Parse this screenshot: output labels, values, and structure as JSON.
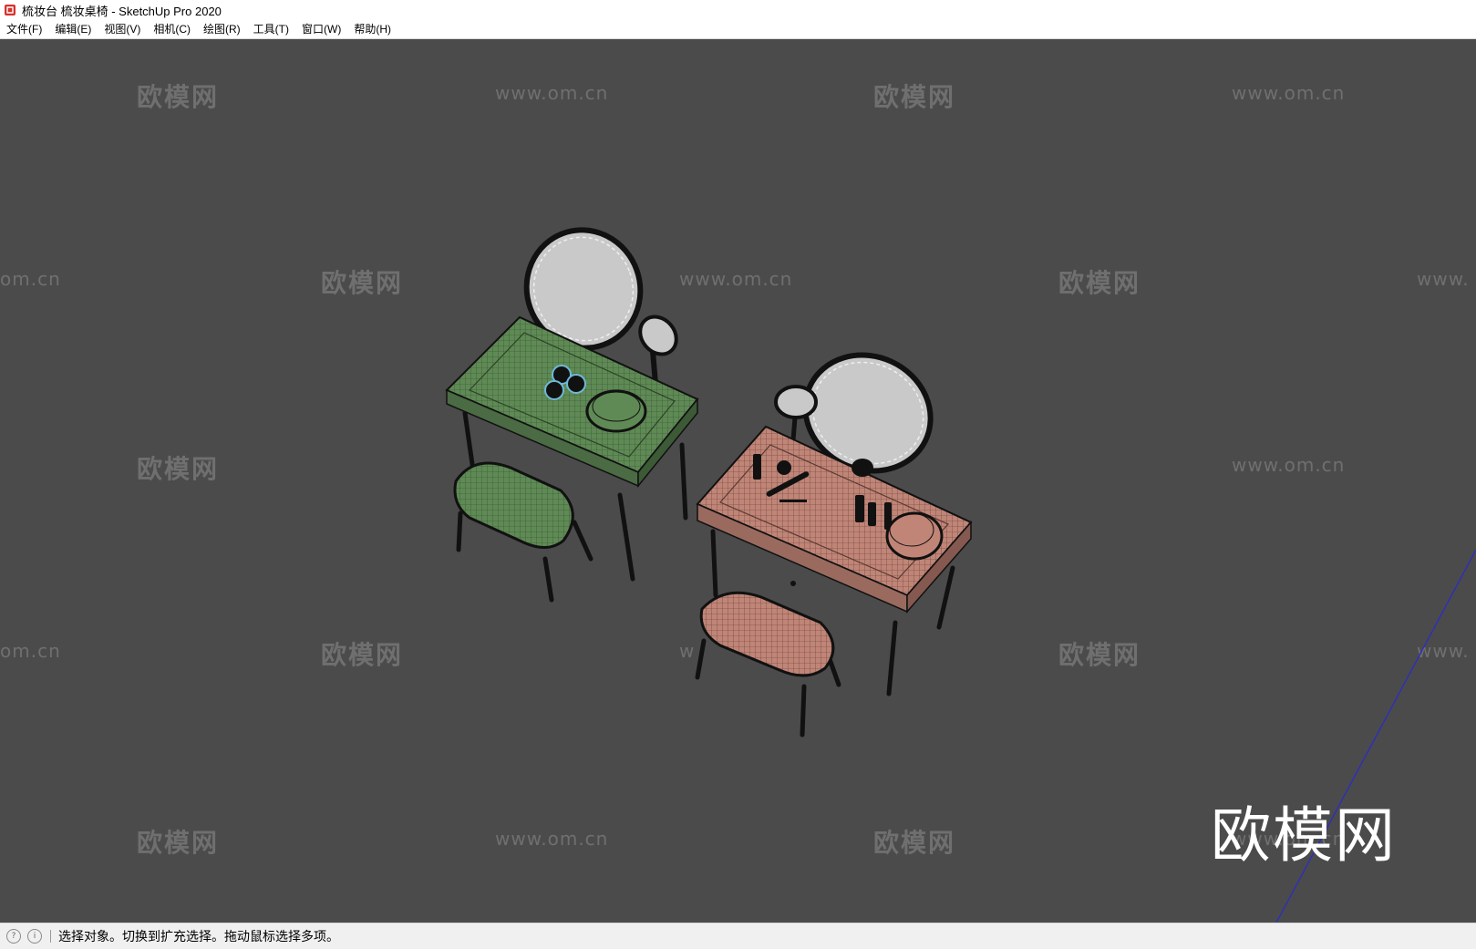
{
  "window": {
    "title": "梳妆台 梳妆桌椅 - SketchUp Pro 2020",
    "app_icon": "sketchup-icon"
  },
  "menu": {
    "items": [
      {
        "label": "文件(F)"
      },
      {
        "label": "编辑(E)"
      },
      {
        "label": "视图(V)"
      },
      {
        "label": "相机(C)"
      },
      {
        "label": "绘图(R)"
      },
      {
        "label": "工具(T)"
      },
      {
        "label": "窗口(W)"
      },
      {
        "label": "帮助(H)"
      }
    ]
  },
  "viewport": {
    "background": "#4b4b4b",
    "watermark_cn": "欧模网",
    "watermark_url": "www.om.cn",
    "watermark_url_partial_left": "om.cn",
    "watermark_url_partial_right": "www.",
    "watermark_url_occluded": "w",
    "logo_text": "欧模网",
    "colors": {
      "green_table": "#5f8a55",
      "pink_table": "#c08577",
      "mirror": "#c9c9c9",
      "axis": "#2a2ad0"
    }
  },
  "status": {
    "icons": [
      "geo-location-icon",
      "info-icon"
    ],
    "message": "选择对象。切换到扩充选择。拖动鼠标选择多项。"
  }
}
